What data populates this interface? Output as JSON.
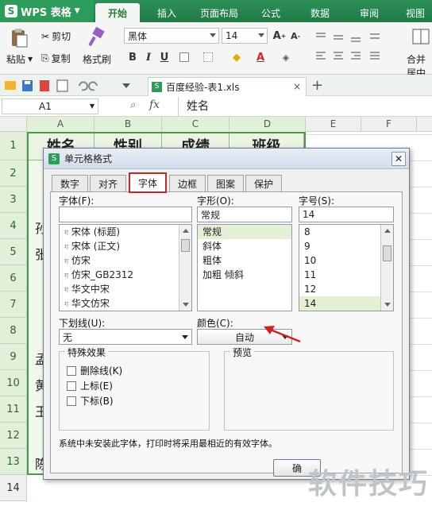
{
  "menubar": {
    "app_label": "WPS 表格",
    "tabs": [
      "开始",
      "插入",
      "页面布局",
      "公式",
      "数据",
      "审阅",
      "视图"
    ]
  },
  "ribbon": {
    "paste": "粘贴",
    "cut": "剪切",
    "copy": "复制",
    "format_painter": "格式刷",
    "font_name": "黑体",
    "font_size": "14",
    "merge_center": "合并居中"
  },
  "doc_tab": "百度经验-表1.xls",
  "formula_bar": {
    "cell_ref": "A1",
    "fx": "fx",
    "content": "姓名"
  },
  "sheet": {
    "columns": [
      "A",
      "B",
      "C",
      "D",
      "E",
      "F"
    ],
    "rows": [
      "1",
      "2",
      "3",
      "4",
      "5",
      "6",
      "7",
      "8",
      "9",
      "10",
      "11",
      "12",
      "13",
      "14"
    ],
    "header_cells": [
      "姓名",
      "性别",
      "成绩",
      "班级"
    ],
    "left_glimpse": {
      "row4": "孙",
      "row5": "张",
      "row9": "孟",
      "row10": "黄",
      "row11": "王",
      "row13": "陈"
    }
  },
  "dialog": {
    "title": "单元格格式",
    "tabs": [
      "数字",
      "对齐",
      "字体",
      "边框",
      "图案",
      "保护"
    ],
    "active_tab": "字体",
    "font_label": "字体(F):",
    "font_value": "",
    "font_list": [
      "宋体 (标题)",
      "宋体 (正文)",
      "仿宋",
      "仿宋_GB2312",
      "华文中宋",
      "华文仿宋"
    ],
    "style_label": "字形(O):",
    "style_value": "常规",
    "style_list": [
      "常规",
      "斜体",
      "粗体",
      "加粗 倾斜"
    ],
    "size_label": "字号(S):",
    "size_value": "14",
    "size_list": [
      "8",
      "9",
      "10",
      "11",
      "12",
      "14"
    ],
    "underline_label": "下划线(U):",
    "underline_value": "无",
    "color_label": "颜色(C):",
    "color_value": "自动",
    "effects_label": "特殊效果",
    "effects": [
      "删除线(K)",
      "上标(E)",
      "下标(B)"
    ],
    "preview_label": "预览",
    "note": "系统中未安装此字体，打印时将采用最相近的有效字体。",
    "ok_partial": "确"
  },
  "watermark": "软件技巧",
  "colors": {
    "wps_green": "#2b9c5a",
    "highlight_red": "#c22828",
    "selected_list": "#e3f0d4"
  }
}
